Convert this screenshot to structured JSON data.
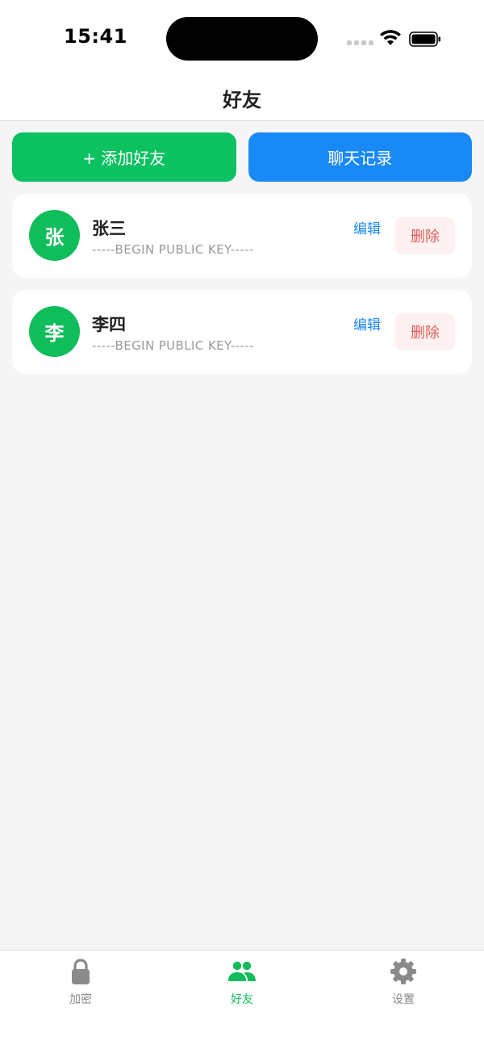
{
  "status_bar": {
    "time": "15:41"
  },
  "nav": {
    "title": "好友"
  },
  "actions": {
    "add_label": "+ 添加好友",
    "chat_label": "聊天记录"
  },
  "friends": [
    {
      "initial": "张",
      "name": "张三",
      "key": "-----BEGIN PUBLIC KEY-----",
      "edit_label": "编辑",
      "delete_label": "删除"
    },
    {
      "initial": "李",
      "name": "李四",
      "key": "-----BEGIN PUBLIC KEY-----",
      "edit_label": "编辑",
      "delete_label": "删除"
    }
  ],
  "tabbar": {
    "items": [
      {
        "label": "加密",
        "icon": "lock-icon",
        "active": false
      },
      {
        "label": "好友",
        "icon": "users-icon",
        "active": true
      },
      {
        "label": "设置",
        "icon": "gear-icon",
        "active": false
      }
    ]
  },
  "colors": {
    "accent_green": "#0cc160",
    "accent_blue": "#1a89f8",
    "danger": "#e25b5b",
    "tab_inactive": "#8a8a8a"
  }
}
